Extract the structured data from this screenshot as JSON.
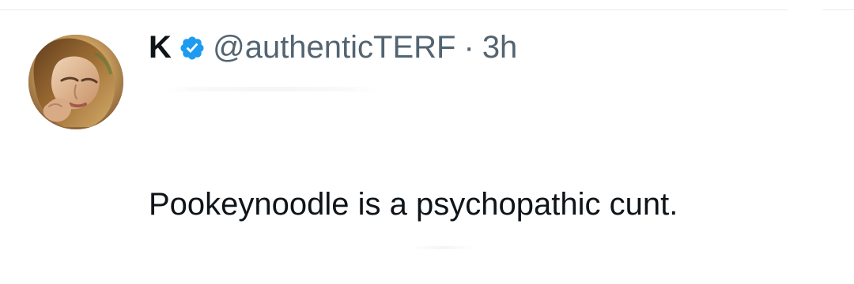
{
  "post": {
    "display_name": "K",
    "handle": "@authenticTERF",
    "separator": "·",
    "timestamp": "3h",
    "text": "Pookeynoodle is a psychopathic cunt."
  },
  "icons": {
    "verified": "verified-badge-icon",
    "avatar": "profile-avatar"
  },
  "colors": {
    "text_primary": "#0f1419",
    "text_secondary": "#536471",
    "verified_blue": "#1d9bf0"
  }
}
